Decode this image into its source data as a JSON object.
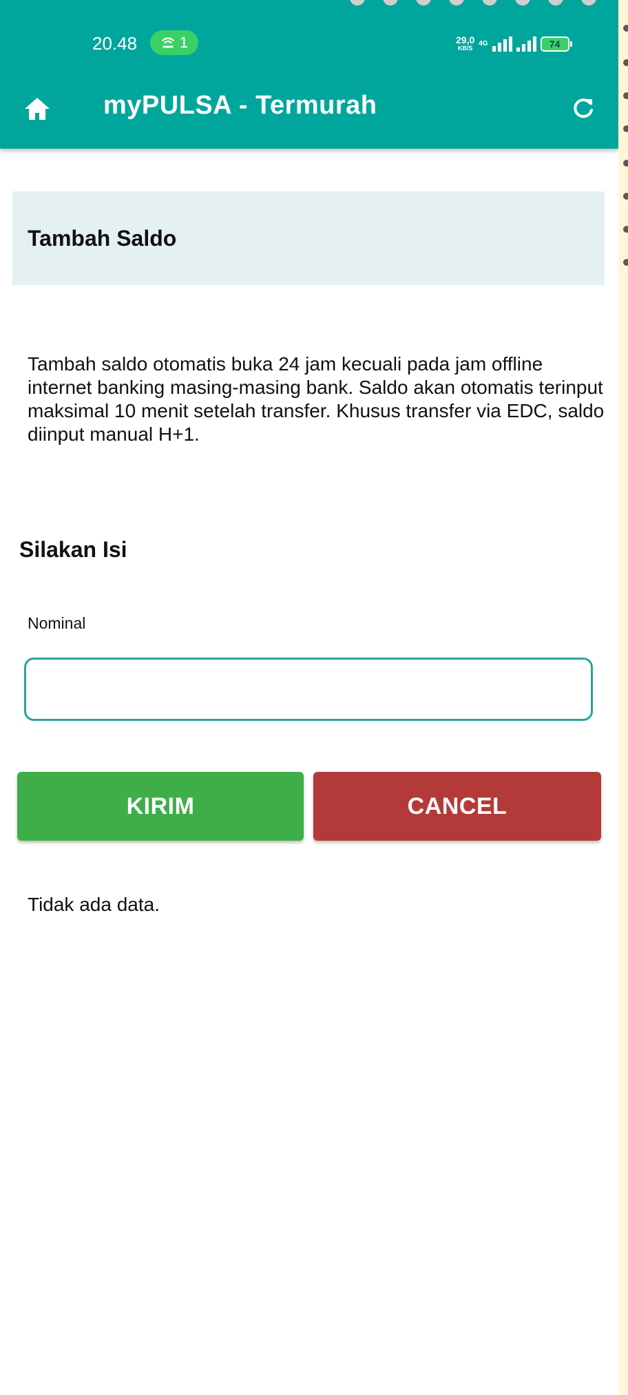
{
  "status_bar": {
    "time": "20.48",
    "hotspot_count": "1",
    "net_speed_value": "29,0",
    "net_speed_unit": "KB/S",
    "network_type": "4G",
    "battery_level": "74"
  },
  "app_bar": {
    "title": "myPULSA - Termurah",
    "home_icon": "home-icon",
    "refresh_icon": "refresh-icon"
  },
  "section": {
    "title": "Tambah Saldo"
  },
  "info": {
    "text": "Tambah saldo otomatis buka 24 jam kecuali pada jam offline internet banking masing-masing bank. Saldo akan otomatis terinput maksimal 10 menit setelah transfer. Khusus transfer via EDC, saldo diinput manual H+1."
  },
  "form": {
    "title": "Silakan Isi",
    "nominal_label": "Nominal",
    "nominal_value": "",
    "submit_label": "KIRIM",
    "cancel_label": "CANCEL"
  },
  "result": {
    "empty_text": "Tidak ada data."
  },
  "colors": {
    "primary": "#00a69c",
    "section_bg": "#e5f0f0",
    "submit": "#3fae48",
    "cancel": "#b43a3a",
    "input_border": "#2ba39a"
  }
}
